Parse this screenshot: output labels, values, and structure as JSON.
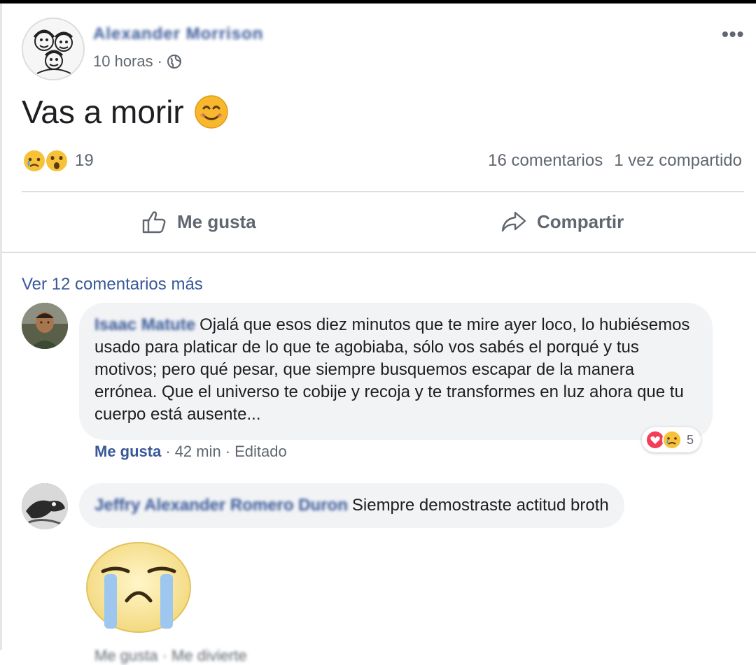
{
  "post": {
    "author": "Alexander Morrison",
    "time": "10 horas",
    "separator": "·",
    "text": "Vas a morir",
    "reactions_count": "19",
    "comments_count": "16 comentarios",
    "shares": "1 vez compartido",
    "like_label": "Me gusta",
    "share_label": "Compartir",
    "more_options": "•••"
  },
  "comments": {
    "see_more": "Ver 12 comentarios más",
    "items": [
      {
        "author": "Isaac Matute",
        "text": "Ojalá que esos diez minutos que te mire ayer loco, lo hubiésemos usado para platicar de lo que te agobiaba, sólo vos sabés el porqué y tus motivos; pero qué pesar, que siempre busquemos escapar de la manera errónea. Que el universo te cobije y recoja y te transformes en luz ahora que tu cuerpo está ausente...",
        "like_label": "Me gusta",
        "sep": "·",
        "time": "42 min",
        "edited": "Editado",
        "reactions_count": "5"
      },
      {
        "author": "Jeffry Alexander Romero Duron",
        "text": "Siempre demostraste actitud broth",
        "footer": "Me gusta · Me divierte"
      }
    ]
  },
  "colors": {
    "link": "#385898",
    "muted": "#606770",
    "bubble": "#f2f3f5",
    "divider": "#dadde1"
  },
  "icons": [
    "globe-icon",
    "smile-emoji-icon",
    "sad-reaction-icon",
    "wow-reaction-icon",
    "thumbs-up-icon",
    "share-arrow-icon",
    "love-reaction-icon",
    "crying-sticker-icon"
  ]
}
